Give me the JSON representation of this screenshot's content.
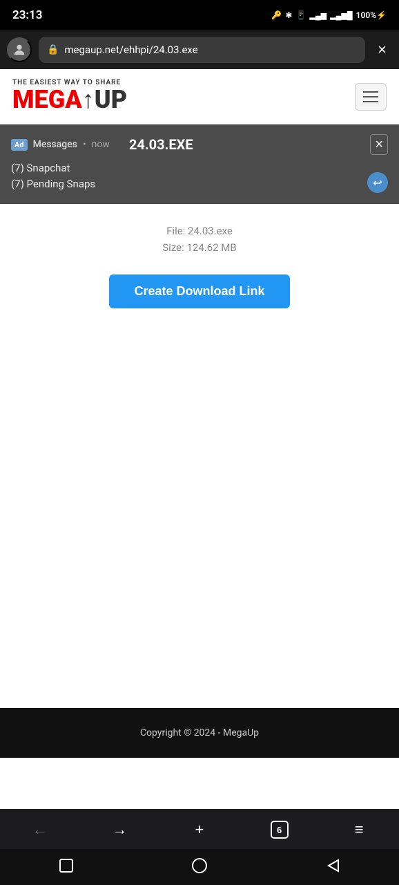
{
  "statusBar": {
    "time": "23:13",
    "batteryLevel": "100",
    "batteryIcon": "🔋"
  },
  "addressBar": {
    "url": "megaup.net/ehhpi/24.03.exe",
    "closeLabel": "×"
  },
  "siteHeader": {
    "logoPrefix": "THE EASIEST WAY TO SHARE",
    "logoMega": "MEGA",
    "logoArrow": "↑",
    "logoUp": "UP",
    "hamburgerAriaLabel": "Menu"
  },
  "notification": {
    "adLabel": "Ad",
    "appName": "Messages",
    "dot": "•",
    "time": "now",
    "overlayTitle": "24.03.EXE",
    "closeLabel": "×",
    "line1": "(7) Snapchat",
    "line2": "(7) Pending Snaps",
    "replyIcon": "↩"
  },
  "mainContent": {
    "fileTitle": "24.03.EXE",
    "fileNameLabel": "File: 24.03.exe",
    "fileSizeLabel": "Size: 124.62 MB",
    "downloadButtonLabel": "Create Download Link"
  },
  "footer": {
    "copyright": "Copyright © 2024 - MegaUp"
  },
  "browserNav": {
    "backLabel": "←",
    "forwardLabel": "→",
    "newTabLabel": "+",
    "tabsCount": "6",
    "menuLabel": "≡"
  }
}
